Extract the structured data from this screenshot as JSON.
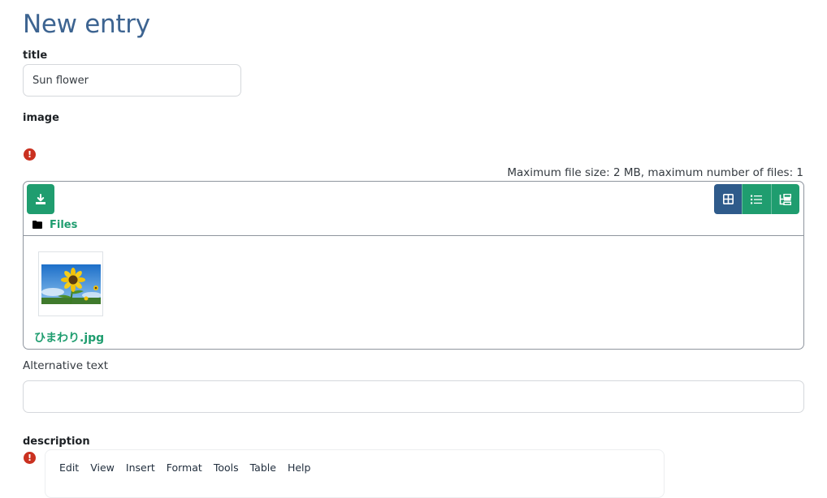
{
  "page": {
    "title": "New entry"
  },
  "fields": {
    "title": {
      "label": "title",
      "value": "Sun flower",
      "placeholder": ""
    },
    "image": {
      "label": "image",
      "error_icon": "exclamation-circle-icon",
      "max_info": "Maximum file size: 2 MB, maximum number of files: 1"
    },
    "filemanager": {
      "upload_icon": "download-icon",
      "views": [
        {
          "name": "icons-view",
          "icon": "grid-icon",
          "active": true
        },
        {
          "name": "list-view",
          "icon": "list-icon",
          "active": false
        },
        {
          "name": "tree-view",
          "icon": "tree-icon",
          "active": false
        }
      ],
      "path_label": "Files",
      "files": [
        {
          "name": "ひまわり.jpg"
        }
      ]
    },
    "alt_text": {
      "label": "Alternative text",
      "value": ""
    },
    "description": {
      "label": "description",
      "menu": [
        "Edit",
        "View",
        "Insert",
        "Format",
        "Tools",
        "Table",
        "Help"
      ]
    }
  },
  "colors": {
    "title": "#3d6491",
    "accent_green": "#1f9d6f",
    "active_blue": "#2f5b8b",
    "error_red": "#ca3120"
  }
}
